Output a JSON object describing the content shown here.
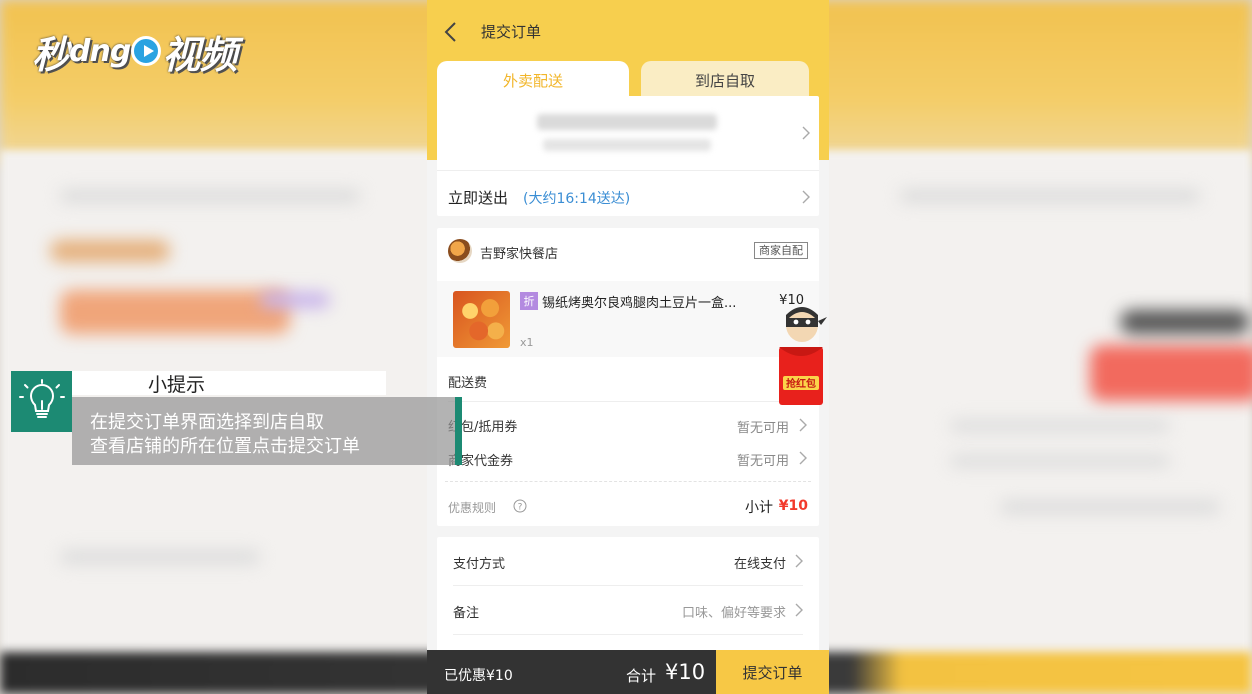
{
  "watermark": {
    "logo_text_left": "秒",
    "logo_text_mid": "dng",
    "logo_text_right": "视频"
  },
  "nav": {
    "title": "提交订单"
  },
  "tabs": [
    {
      "label": "外卖配送",
      "active": true
    },
    {
      "label": "到店自取",
      "active": false
    }
  ],
  "delivery": {
    "label": "立即送出",
    "eta": "(大约16:14送达)"
  },
  "shop": {
    "name": "吉野家快餐店",
    "badge": "商家自配"
  },
  "item": {
    "tag": "折",
    "name": "锡纸烤奥尔良鸡腿肉土豆片一盒...",
    "price": "¥10",
    "qty": "x1"
  },
  "fees": {
    "delivery_fee_label": "配送费",
    "coupon_label": "红包/抵用券",
    "coupon_value": "暂无可用",
    "voucher_label": "商家代金券",
    "voucher_value": "暂无可用"
  },
  "summary": {
    "rule_label": "优惠规则",
    "subtotal_label": "小计",
    "subtotal_value": "¥10"
  },
  "payment": {
    "method_label": "支付方式",
    "method_value": "在线支付",
    "remark_label": "备注",
    "remark_placeholder": "口味、偏好等要求"
  },
  "bottom": {
    "saved": "已优惠¥10",
    "total_label": "合计",
    "total_value": "¥10",
    "submit": "提交订单"
  },
  "mascot": {
    "envelope_text": "抢红包"
  },
  "tip": {
    "title": "小提示",
    "line1": "在提交订单界面选择到店自取",
    "line2": "查看店铺的所在位置点击提交订单"
  },
  "colors": {
    "brand_yellow": "#f7cf4e",
    "price_red": "#f23a2c",
    "eta_blue": "#3b8ed4",
    "tip_green": "#1c8a73"
  }
}
